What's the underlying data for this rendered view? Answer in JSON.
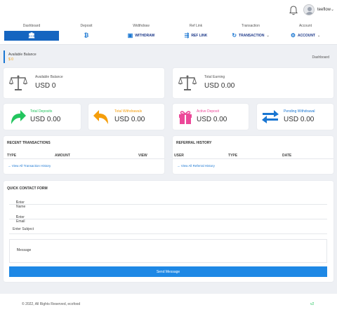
{
  "header": {
    "username": "teeflow"
  },
  "nav": [
    {
      "caption": "Dashboard",
      "label": "",
      "icon": "bank-icon"
    },
    {
      "caption": "Deposit",
      "label": "",
      "icon": "bitcoin-icon"
    },
    {
      "caption": "Widthdraw",
      "label": "WITHDRAW",
      "icon": "cash-icon"
    },
    {
      "caption": "Ref Link",
      "label": "REF LINK",
      "icon": "link-arrow-icon"
    },
    {
      "caption": "Transaction",
      "label": "TRANSACTION",
      "icon": "history-icon"
    },
    {
      "caption": "Account",
      "label": "ACCOUNT",
      "icon": "gear-icon"
    }
  ],
  "page": {
    "title": "Available Balance",
    "balance": "$ 0",
    "breadcrumb": "Dashboard"
  },
  "stats": {
    "available": {
      "label": "Available Balance",
      "value": "USD 0"
    },
    "earning": {
      "label": "Total Earning",
      "value": "USD 0.00"
    }
  },
  "summary": [
    {
      "label": "Total Deposits",
      "value": "USD 0.00",
      "color": "#22c55e"
    },
    {
      "label": "Total Withdrawals",
      "value": "USD 0.00",
      "color": "#f59e0b"
    },
    {
      "label": "Active Deposit",
      "value": "USD 0.00",
      "color": "#ec4899"
    },
    {
      "label": "Pending Withdrawal",
      "value": "USD 0.00",
      "color": "#1976d2"
    }
  ],
  "recent": {
    "title": "RECENT TRANSACTIONS",
    "columns": [
      "TYPE",
      "AMOUNT",
      "VIEW"
    ],
    "link": "→ View All Transaction History"
  },
  "referral": {
    "title": "REFERRAL HISTORY",
    "columns": [
      "USER",
      "TYPE",
      "DATE"
    ],
    "link": "→ View All Referral History"
  },
  "contact": {
    "title": "QUICK CONTACT FORM",
    "name": "Enter Name",
    "email": "Enter Email",
    "subject": "Enter Subject",
    "message": "Message",
    "button": "Send Message"
  },
  "footer": {
    "copyright": "© 2022, All Rights Reserved, ecofood",
    "version": "v2"
  }
}
